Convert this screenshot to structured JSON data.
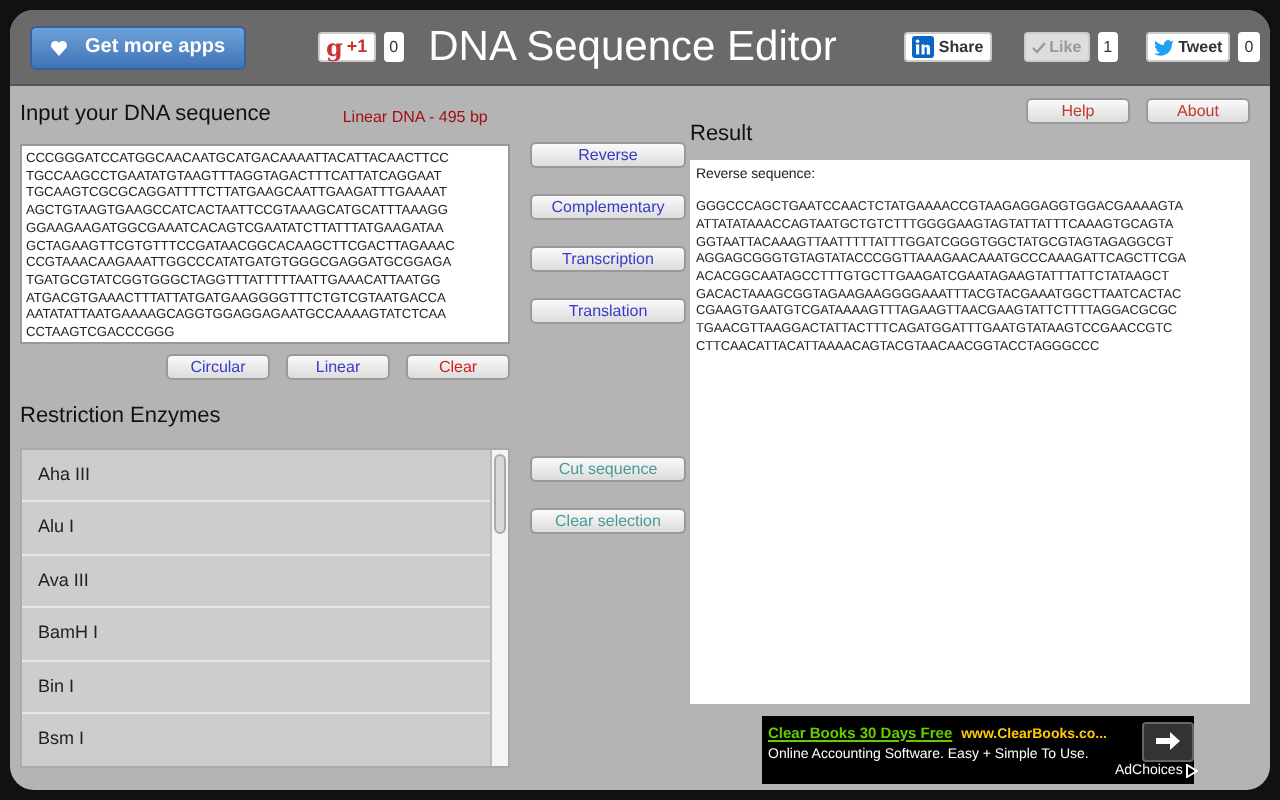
{
  "header": {
    "apps_button": "Get more apps",
    "gplus": {
      "icon": "g",
      "label": "+1",
      "count": "0"
    },
    "title": "DNA Sequence Editor",
    "linkedin": {
      "label": "Share"
    },
    "like": {
      "label": "Like",
      "count": "1"
    },
    "tweet": {
      "label": "Tweet",
      "count": "0"
    }
  },
  "input": {
    "heading": "Input your DNA sequence",
    "info": "Linear DNA - 495 bp",
    "lines": [
      "CCCGGGATCCATGGCAACAATGCATGACAAAATTACATTACAACTTCC",
      "TGCCAAGCCTGAATATGTAAGTTTAGGTAGACTTTCATTATCAGGAAT",
      "TGCAAGTCGCGCAGGATTTTCTTATGAAGCAATTGAAGATTTGAAAAT",
      "AGCTGTAAGTGAAGCCATCACTAATTCCGTAAAGCATGCATTTAAAGG",
      "GGAAGAAGATGGCGAAATCACAGTCGAATATCTTATTTATGAAGATAA",
      "GCTAGAAGTTCGTGTTTCCGATAACGGCACAAGCTTCGACTTAGAAAC",
      "CCGTAAACAAGAAATTGGCCCATATGATGTGGGCGAGGATGCGGAGA",
      "TGATGCGTATCGGTGGGCTAGGTTTATTTTTAATTGAAACATTAATGG",
      "ATGACGTGAAACTTTATTATGATGAAGGGGTTTCTGTCGTAATGACCA",
      "AATATATTAATGAAAAGCAGGTGGAGGAGAATGCCAAAAGTATCTCAA",
      "CCTAAGTCGACCCGGG"
    ],
    "buttons": [
      {
        "label": "Circular",
        "kind": "normal"
      },
      {
        "label": "Linear",
        "kind": "normal"
      },
      {
        "label": "Clear",
        "kind": "danger"
      }
    ]
  },
  "actions": [
    {
      "label": "Reverse",
      "disabled": false
    },
    {
      "label": "Complementary",
      "disabled": false
    },
    {
      "label": "Transcription",
      "disabled": false
    },
    {
      "label": "Translation",
      "disabled": false
    }
  ],
  "enzymes": {
    "heading": "Restriction Enzymes",
    "items": [
      "Aha III",
      "Alu I",
      "Ava III",
      "BamH I",
      "Bin I",
      "Bsm I"
    ]
  },
  "enzyme_actions": [
    {
      "label": "Cut sequence",
      "disabled": true
    },
    {
      "label": "Clear selection",
      "disabled": true
    }
  ],
  "top_buttons": [
    "Help",
    "About"
  ],
  "result": {
    "heading": "Result",
    "caption": "Reverse sequence:",
    "lines": [
      "GGGCCCAGCTGAATCCAACTCTATGAAAACCGTAAGAGGAGGTGGACGAAAAGTA",
      "ATTATATAAACCAGTAATGCTGTCTTTGGGGAAGTAGTATTATTTCAAAGTGCAGTA",
      "GGTAATTACAAAGTTAATTTTTATTTGGATCGGGTGGCTATGCGTAGTAGAGGCGT",
      "AGGAGCGGGTGTAGTATACCCGGTTAAAGAACAAATGCCCAAAGATTCAGCTTCGA",
      "ACACGGCAATAGCCTTTGTGCTTGAAGATCGAATAGAAGTATTTATTCTATAAGCT",
      "GACACTAAAGCGGTAGAAGAAGGGGAAATTTACGTACGAAATGGCTTAATCACTAC",
      "CGAAGTGAATGTCGATAAAAGTTTAGAAGTTAACGAAGTATTCTTTTAGGACGCGC",
      "TGAACGTTAAGGACTATTACTTTCAGATGGATTTGAATGTATAAGTCCGAACCGTC",
      "CTTCAACATTACATTAAAACAGTACGTAACAACGGTACCTAGGGCCC"
    ]
  },
  "ad": {
    "headline": "Clear Books 30 Days Free",
    "url": "www.ClearBooks.co...",
    "text": "Online Accounting Software. Easy + Simple To Use.",
    "choices": "AdChoices"
  }
}
